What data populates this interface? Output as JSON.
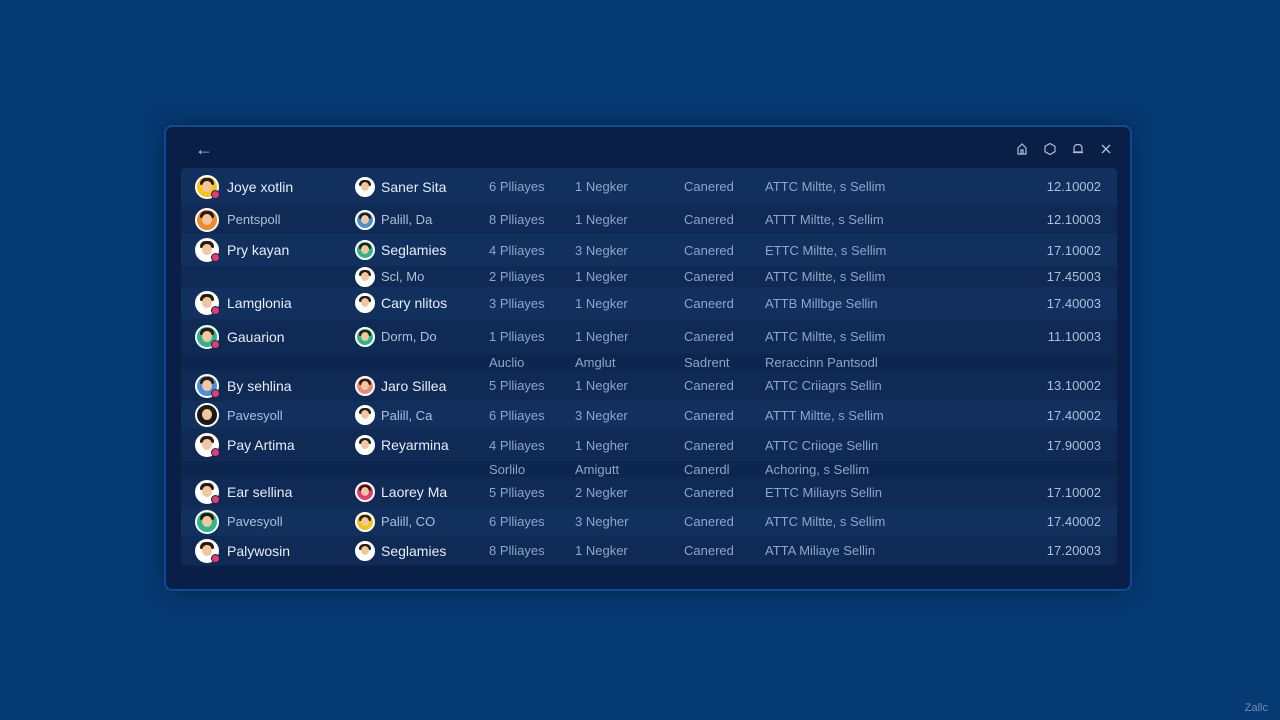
{
  "window": {
    "back_label": "←",
    "icons": [
      "home-icon",
      "hexagon-icon",
      "bell-icon",
      "close-icon"
    ],
    "accent": "#0d4a9a"
  },
  "rows": [
    {
      "kind": "main",
      "name": "Joye xotlin",
      "name_dim": false,
      "opp": "Saner Sita",
      "opp_dim": false,
      "players": "6 Plliayes",
      "neg": "1 Negker",
      "status": "Canered",
      "desc": "ATTC Miltte, s Sellim",
      "num": "12.10002",
      "av1": "#f5c518",
      "av2": "#ffffff"
    },
    {
      "kind": "main",
      "name": "Pentspoll",
      "name_dim": true,
      "opp": "Palill, Da",
      "opp_dim": true,
      "players": "8 Plliayes",
      "neg": "1 Negker",
      "status": "Canered",
      "desc": "ATTT Miltte, s Sellim",
      "num": "12.10003",
      "av1": "#f08a2a",
      "av2": "#4a90d9"
    },
    {
      "kind": "main",
      "name": "Pry kayan",
      "name_dim": false,
      "opp": "Seglamies",
      "opp_dim": false,
      "players": "4 Plliayes",
      "neg": "3 Negker",
      "status": "Canered",
      "desc": "ETTC Miltte, s Sellim",
      "num": "17.10002",
      "av1": "#ffffff",
      "av2": "#2fb58a"
    },
    {
      "kind": "opp-only",
      "opp": "Scl, Mo",
      "opp_dim": true,
      "players": "2 Plliayes",
      "neg": "1 Negker",
      "status": "Canered",
      "desc": "ATTC Miltte, s Sellim",
      "num": "17.45003",
      "av2": "#ffffff"
    },
    {
      "kind": "main",
      "name": "Lamglonia",
      "name_dim": false,
      "opp": "Cary nlitos",
      "opp_dim": false,
      "players": "3 Plliayes",
      "neg": "1 Negker",
      "status": "Caneerd",
      "desc": "ATTB Millbge Sellin",
      "num": "17.40003",
      "av1": "#ffffff",
      "av2": "#ffffff"
    },
    {
      "kind": "main",
      "name": "Gauarion",
      "name_dim": false,
      "opp": "Dorm, Do",
      "opp_dim": true,
      "players": "1 Plliayes",
      "neg": "1 Negher",
      "status": "Canered",
      "desc": "ATTC Miltte, s Sellim",
      "num": "11.10003",
      "av1": "#2fb58a",
      "av2": "#2fb58a"
    },
    {
      "kind": "header",
      "players": "Auclio",
      "neg": "Amglut",
      "status": "Sadrent",
      "desc": "Reraccinn Pantsodl"
    },
    {
      "kind": "main",
      "name": "By sehlina",
      "name_dim": false,
      "opp": "Jaro Sillea",
      "opp_dim": false,
      "players": "5 Plliayes",
      "neg": "1 Negker",
      "status": "Canered",
      "desc": "ATTC Criiagrs Sellin",
      "num": "13.10002",
      "av1": "#4a90d9",
      "av2": "#e88a7a"
    },
    {
      "kind": "main",
      "name": "Pavesyoll",
      "name_dim": true,
      "opp": "Palill, Ca",
      "opp_dim": true,
      "players": "6 Plliayes",
      "neg": "3 Negker",
      "status": "Canered",
      "desc": "ATTT Miltte, s Sellim",
      "num": "17.40002",
      "av1": "#1a1a1a",
      "av2": "#ffffff"
    },
    {
      "kind": "main",
      "name": "Pay Artima",
      "name_dim": false,
      "opp": "Reyarmina",
      "opp_dim": false,
      "players": "4 Plliayes",
      "neg": "1 Negher",
      "status": "Canered",
      "desc": "ATTC Criioge Sellin",
      "num": "17.90003",
      "av1": "#ffffff",
      "av2": "#ffffff"
    },
    {
      "kind": "header",
      "players": "Sorlilo",
      "neg": "Amigutt",
      "status": "Canerdl",
      "desc": "Achoring, s Sellim"
    },
    {
      "kind": "main",
      "name": "Ear sellina",
      "name_dim": false,
      "opp": "Laorey Ma",
      "opp_dim": false,
      "players": "5 Plliayes",
      "neg": "2 Negker",
      "status": "Canered",
      "desc": "ETTC Miliayrs Sellin",
      "num": "17.10002",
      "av1": "#ffffff",
      "av2": "#e83a6c"
    },
    {
      "kind": "main",
      "name": "Pavesyoll",
      "name_dim": true,
      "opp": "Palill, CO",
      "opp_dim": true,
      "players": "6 Plliayes",
      "neg": "3 Negher",
      "status": "Canered",
      "desc": "ATTC Miltte, s Sellim",
      "num": "17.40002",
      "av1": "#2fb58a",
      "av2": "#f5c518"
    },
    {
      "kind": "main",
      "name": "Palywosin",
      "name_dim": false,
      "opp": "Seglamies",
      "opp_dim": false,
      "players": "8 Plliayes",
      "neg": "1 Negker",
      "status": "Canered",
      "desc": "ATTA Miliaye Sellin",
      "num": "17.20003",
      "av1": "#ffffff",
      "av2": "#ffffff"
    }
  ],
  "watermark": "Zallc"
}
